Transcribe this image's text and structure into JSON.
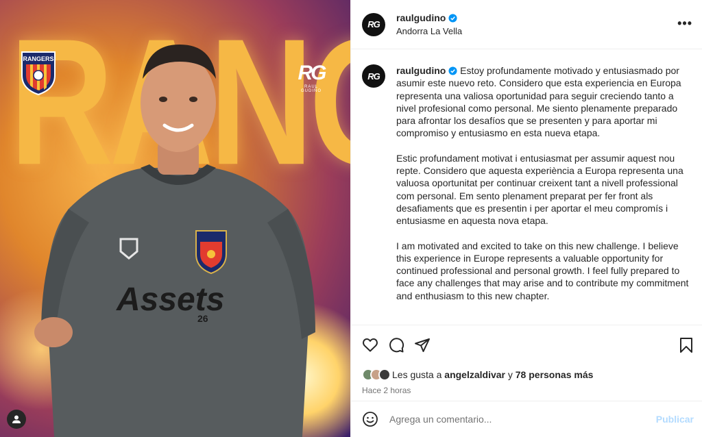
{
  "media": {
    "background_word": "RANGERS",
    "crest_text": "RANGERS",
    "brand_mark": "RG",
    "brand_name": "RAUL GUDIÑO",
    "sponsor": "Assets",
    "sponsor_num": "26"
  },
  "header": {
    "username": "raulgudino",
    "location": "Andorra La Vella",
    "more_icon": "more-horizontal-icon"
  },
  "caption": {
    "username": "raulgudino",
    "paragraph_es": "Estoy profundamente motivado y entusiasmado por asumir este nuevo reto. Considero que esta experiencia en Europa representa una valiosa oportunidad para seguir creciendo tanto a nivel profesional como personal. Me siento plenamente preparado para afrontar los desafíos que se presenten y para aportar mi compromiso y entusiasmo en esta nueva etapa.",
    "paragraph_ca": "Estic profundament motivat i entusiasmat per assumir aquest nou repte. Considero que aquesta experiència a Europa representa una valuosa oportunitat per continuar creixent tant a nivell professional com personal. Em sento plenament preparat per fer front als desafiaments que es presentin i per aportar el meu compromís i entusiasme en aquesta nova etapa.",
    "paragraph_en": "I am motivated and excited to take on this new challenge. I believe this experience in Europe represents a valuable opportunity for continued professional and personal growth. I feel fully prepared to face any challenges that may arise and to contribute my commitment and enthusiasm to this new chapter."
  },
  "likes": {
    "prefix": "Les gusta a",
    "user": "angelzaldivar",
    "connector": "y",
    "others": "78 personas más"
  },
  "time": "Hace 2 horas",
  "comment": {
    "placeholder": "Agrega un comentario...",
    "post_label": "Publicar"
  },
  "colors": {
    "verified": "#0095f6",
    "post_disabled": "#b3dbff",
    "text": "#262626",
    "muted": "#737373"
  }
}
